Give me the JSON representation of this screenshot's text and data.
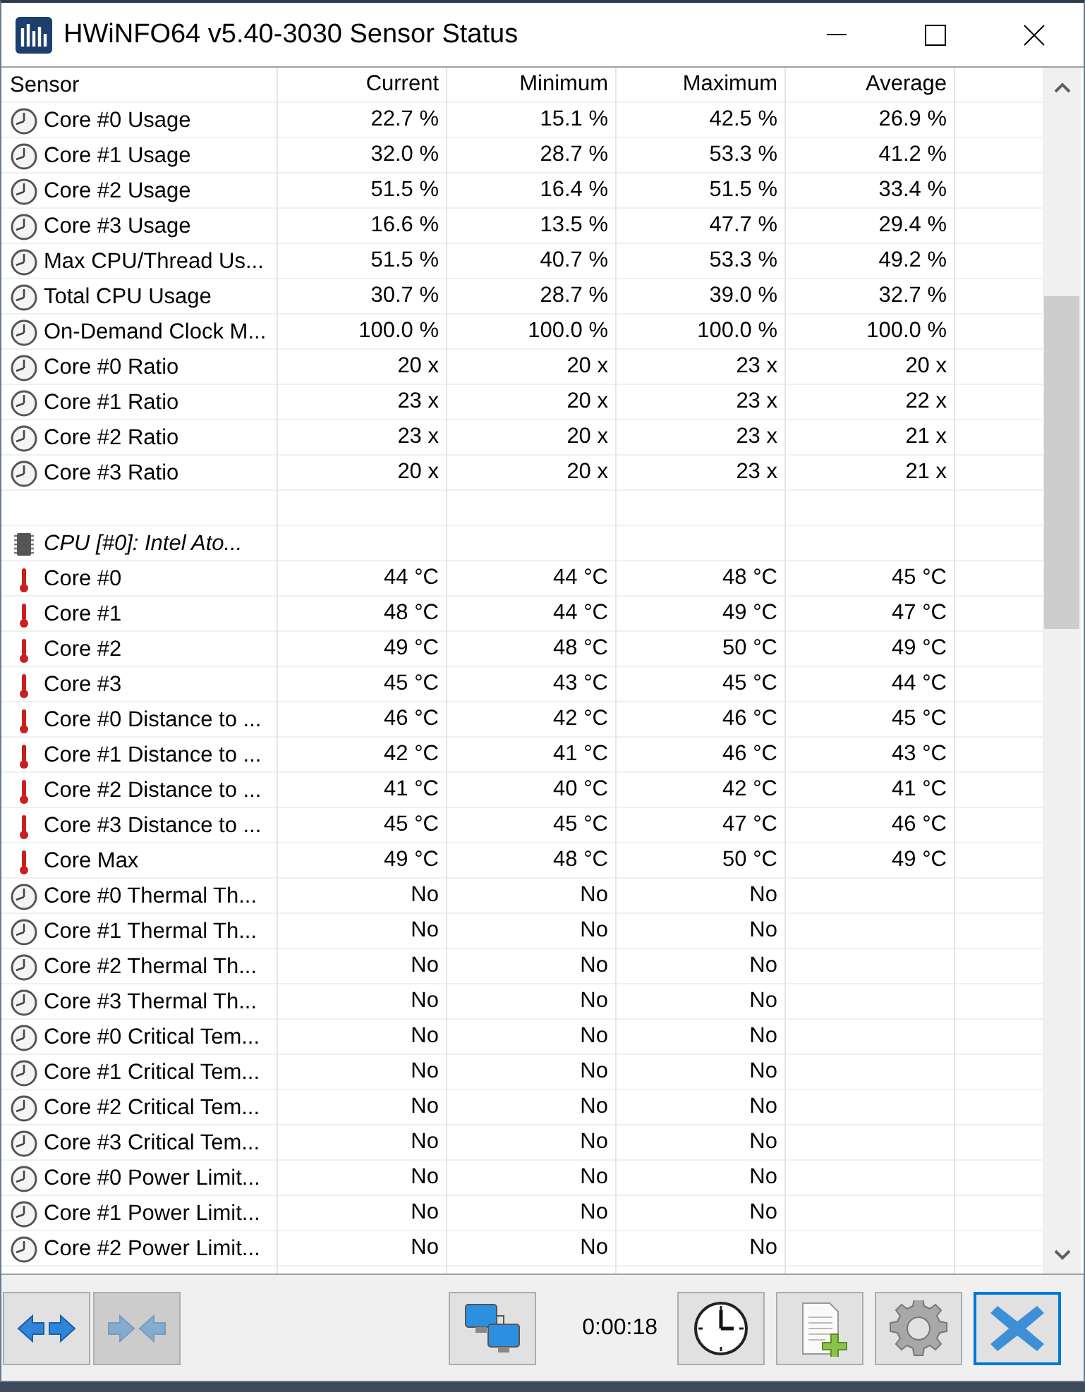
{
  "window": {
    "title": "HWiNFO64 v5.40-3030 Sensor Status"
  },
  "table": {
    "columns": [
      "Sensor",
      "Current",
      "Minimum",
      "Maximum",
      "Average"
    ],
    "rows": [
      {
        "kind": "usage",
        "sensor": "Core #0 Usage",
        "current": "22.7 %",
        "minimum": "15.1 %",
        "maximum": "42.5 %",
        "average": "26.9 %"
      },
      {
        "kind": "usage",
        "sensor": "Core #1 Usage",
        "current": "32.0 %",
        "minimum": "28.7 %",
        "maximum": "53.3 %",
        "average": "41.2 %"
      },
      {
        "kind": "usage",
        "sensor": "Core #2 Usage",
        "current": "51.5 %",
        "minimum": "16.4 %",
        "maximum": "51.5 %",
        "average": "33.4 %"
      },
      {
        "kind": "usage",
        "sensor": "Core #3 Usage",
        "current": "16.6 %",
        "minimum": "13.5 %",
        "maximum": "47.7 %",
        "average": "29.4 %"
      },
      {
        "kind": "usage",
        "sensor": "Max CPU/Thread Us...",
        "current": "51.5 %",
        "minimum": "40.7 %",
        "maximum": "53.3 %",
        "average": "49.2 %"
      },
      {
        "kind": "usage",
        "sensor": "Total CPU Usage",
        "current": "30.7 %",
        "minimum": "28.7 %",
        "maximum": "39.0 %",
        "average": "32.7 %"
      },
      {
        "kind": "usage",
        "sensor": "On-Demand Clock M...",
        "current": "100.0 %",
        "minimum": "100.0 %",
        "maximum": "100.0 %",
        "average": "100.0 %"
      },
      {
        "kind": "usage",
        "sensor": "Core #0 Ratio",
        "current": "20 x",
        "minimum": "20 x",
        "maximum": "23 x",
        "average": "20 x"
      },
      {
        "kind": "usage",
        "sensor": "Core #1 Ratio",
        "current": "23 x",
        "minimum": "20 x",
        "maximum": "23 x",
        "average": "22 x"
      },
      {
        "kind": "usage",
        "sensor": "Core #2 Ratio",
        "current": "23 x",
        "minimum": "20 x",
        "maximum": "23 x",
        "average": "21 x"
      },
      {
        "kind": "usage",
        "sensor": "Core #3 Ratio",
        "current": "20 x",
        "minimum": "20 x",
        "maximum": "23 x",
        "average": "21 x"
      },
      {
        "kind": "blank"
      },
      {
        "kind": "group",
        "sensor": "CPU [#0]: Intel Ato..."
      },
      {
        "kind": "temperature",
        "sensor": "Core #0",
        "current": "44 °C",
        "minimum": "44 °C",
        "maximum": "48 °C",
        "average": "45 °C"
      },
      {
        "kind": "temperature",
        "sensor": "Core #1",
        "current": "48 °C",
        "minimum": "44 °C",
        "maximum": "49 °C",
        "average": "47 °C"
      },
      {
        "kind": "temperature",
        "sensor": "Core #2",
        "current": "49 °C",
        "minimum": "48 °C",
        "maximum": "50 °C",
        "average": "49 °C"
      },
      {
        "kind": "temperature",
        "sensor": "Core #3",
        "current": "45 °C",
        "minimum": "43 °C",
        "maximum": "45 °C",
        "average": "44 °C"
      },
      {
        "kind": "temperature",
        "sensor": "Core #0 Distance to ...",
        "current": "46 °C",
        "minimum": "42 °C",
        "maximum": "46 °C",
        "average": "45 °C"
      },
      {
        "kind": "temperature",
        "sensor": "Core #1 Distance to ...",
        "current": "42 °C",
        "minimum": "41 °C",
        "maximum": "46 °C",
        "average": "43 °C"
      },
      {
        "kind": "temperature",
        "sensor": "Core #2 Distance to ...",
        "current": "41 °C",
        "minimum": "40 °C",
        "maximum": "42 °C",
        "average": "41 °C"
      },
      {
        "kind": "temperature",
        "sensor": "Core #3 Distance to ...",
        "current": "45 °C",
        "minimum": "45 °C",
        "maximum": "47 °C",
        "average": "46 °C"
      },
      {
        "kind": "temperature",
        "sensor": "Core Max",
        "current": "49 °C",
        "minimum": "48 °C",
        "maximum": "50 °C",
        "average": "49 °C"
      },
      {
        "kind": "usage",
        "sensor": "Core #0 Thermal Th...",
        "current": "No",
        "minimum": "No",
        "maximum": "No"
      },
      {
        "kind": "usage",
        "sensor": "Core #1 Thermal Th...",
        "current": "No",
        "minimum": "No",
        "maximum": "No"
      },
      {
        "kind": "usage",
        "sensor": "Core #2 Thermal Th...",
        "current": "No",
        "minimum": "No",
        "maximum": "No"
      },
      {
        "kind": "usage",
        "sensor": "Core #3 Thermal Th...",
        "current": "No",
        "minimum": "No",
        "maximum": "No"
      },
      {
        "kind": "usage",
        "sensor": "Core #0 Critical Tem...",
        "current": "No",
        "minimum": "No",
        "maximum": "No"
      },
      {
        "kind": "usage",
        "sensor": "Core #1 Critical Tem...",
        "current": "No",
        "minimum": "No",
        "maximum": "No"
      },
      {
        "kind": "usage",
        "sensor": "Core #2 Critical Tem...",
        "current": "No",
        "minimum": "No",
        "maximum": "No"
      },
      {
        "kind": "usage",
        "sensor": "Core #3 Critical Tem...",
        "current": "No",
        "minimum": "No",
        "maximum": "No"
      },
      {
        "kind": "usage",
        "sensor": "Core #0 Power Limit...",
        "current": "No",
        "minimum": "No",
        "maximum": "No"
      },
      {
        "kind": "usage",
        "sensor": "Core #1 Power Limit...",
        "current": "No",
        "minimum": "No",
        "maximum": "No"
      },
      {
        "kind": "usage",
        "sensor": "Core #2 Power Limit...",
        "current": "No",
        "minimum": "No",
        "maximum": "No"
      }
    ]
  },
  "toolbar": {
    "left_buttons": [
      {
        "kind": "expand",
        "disabled": false
      },
      {
        "kind": "collapse",
        "disabled": true
      }
    ],
    "network_button": {
      "kind": "network",
      "disabled": false
    },
    "elapsed": "0:00:18",
    "right_buttons": [
      {
        "kind": "clock",
        "disabled": false,
        "focused": false
      },
      {
        "kind": "report",
        "disabled": false,
        "focused": false
      },
      {
        "kind": "settings",
        "disabled": false,
        "focused": false
      },
      {
        "kind": "close",
        "disabled": false,
        "focused": true
      }
    ]
  }
}
